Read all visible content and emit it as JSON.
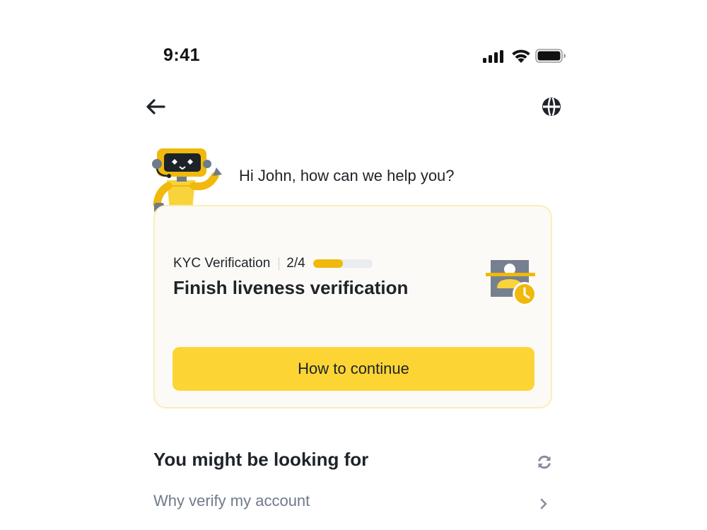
{
  "status_bar": {
    "time": "9:41",
    "icons": [
      "signal-icon",
      "wifi-icon",
      "battery-icon"
    ]
  },
  "nav": {
    "back_icon": "arrow-left-icon",
    "language_icon": "globe-icon"
  },
  "assistant": {
    "avatar": "robot-mascot",
    "greeting": "Hi John, how can we help you?"
  },
  "kyc_card": {
    "label": "KYC Verification",
    "step": "2/4",
    "progress_fraction": 0.5,
    "title": "Finish liveness verification",
    "illustration": "id-card-clock-icon",
    "button_label": "How to continue"
  },
  "suggestions": {
    "title": "You might be looking for",
    "refresh_icon": "refresh-icon",
    "items": [
      {
        "label": "Why verify my account",
        "icon": "chevron-right-icon"
      }
    ]
  },
  "colors": {
    "accent_yellow": "#fcd535",
    "progress_yellow": "#f0b90b",
    "card_border": "#fbeeb4",
    "card_background": "#fcfaf6",
    "text_primary": "#1e2329",
    "text_secondary": "#707a8a"
  }
}
